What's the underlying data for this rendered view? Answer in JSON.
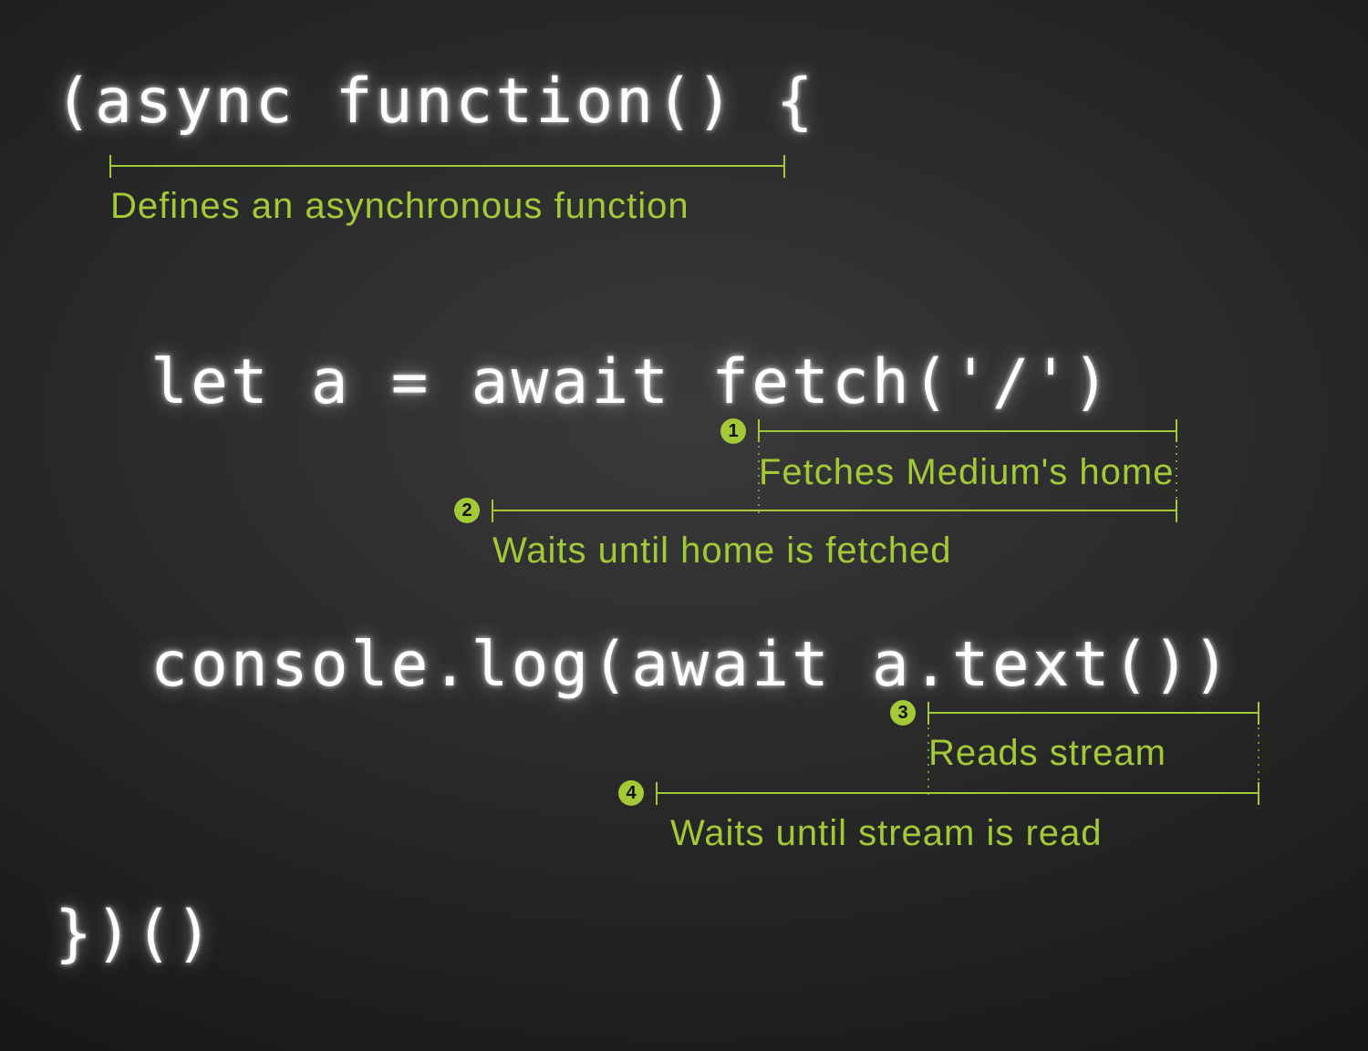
{
  "code": {
    "line1": "(async function() {",
    "line2": "let a = await fetch('/')",
    "line3": "console.log(await a.text())",
    "line4": "})()"
  },
  "annotations": {
    "a0": {
      "text": "Defines an asynchronous function"
    },
    "a1": {
      "num": "1",
      "text": "Fetches Medium's home"
    },
    "a2": {
      "num": "2",
      "text": "Waits until home is fetched"
    },
    "a3": {
      "num": "3",
      "text": "Reads stream"
    },
    "a4": {
      "num": "4",
      "text": "Waits until stream is read"
    }
  },
  "colors": {
    "accent": "#a3c838",
    "code": "#fdfdfd"
  }
}
